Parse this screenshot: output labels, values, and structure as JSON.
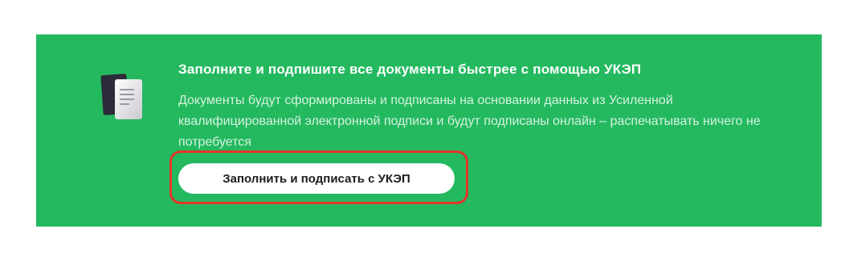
{
  "banner": {
    "icon": "documents-icon",
    "title": "Заполните и подпишите все документы быстрее с помощью УКЭП",
    "description": "Документы будут сформированы и подписаны на основании данных из Усиленной квалифицированной электронной подписи и будут подписаны онлайн – распечатывать ничего не потребуется",
    "cta_label": "Заполнить и подписать с УКЭП",
    "colors": {
      "background": "#24b95f",
      "title": "#ffffff",
      "description": "#d4f2df",
      "button_bg": "#ffffff",
      "highlight_outline": "#e6332a"
    }
  }
}
